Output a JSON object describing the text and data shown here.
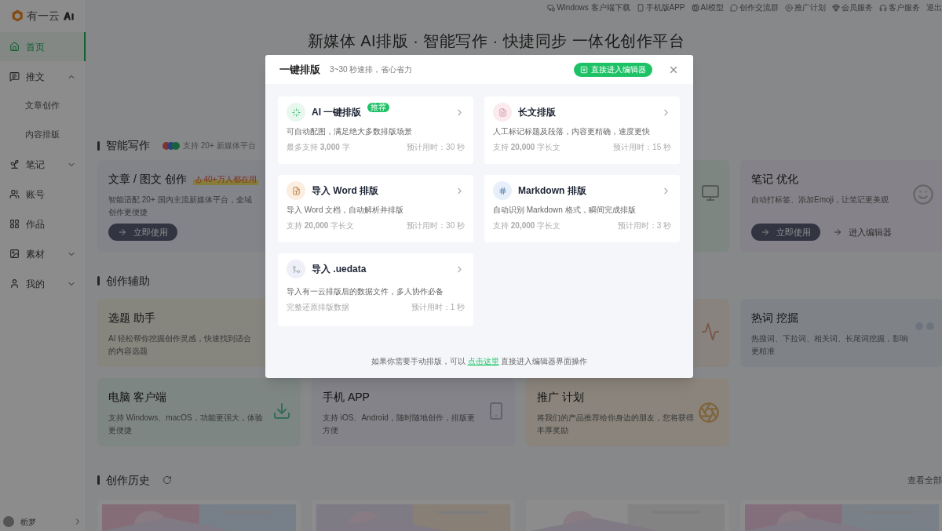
{
  "logo": {
    "text": "有一云"
  },
  "top_links": [
    "Windows 客户端下载",
    "手机版APP",
    "AI模型",
    "创作交流群",
    "推广计划",
    "会员服务",
    "客户服务",
    "退出"
  ],
  "sidebar": {
    "items": [
      {
        "label": "首页",
        "selected": true
      },
      {
        "label": "推文",
        "selected": false,
        "expanded": true,
        "children": [
          {
            "label": "文章创作",
            "selected": false
          },
          {
            "label": "内容排版",
            "selected": false
          }
        ]
      },
      {
        "label": "笔记",
        "selected": false,
        "expanded": false
      },
      {
        "label": "账号",
        "selected": false
      },
      {
        "label": "作品",
        "selected": false
      },
      {
        "label": "素材",
        "selected": false,
        "expanded": false
      },
      {
        "label": "我的",
        "selected": false,
        "expanded": false
      }
    ],
    "user": {
      "name": "栀梦"
    }
  },
  "headline": "新媒体 AI排版 · 智能写作 · 快捷同步 一体化创作平台",
  "writing": {
    "title": "智能写作",
    "note": "支持 20+ 新媒体平台",
    "cards": [
      {
        "kind": "card",
        "title": "文章 / 图文 创作",
        "tag": "40+万人都在用",
        "description": "智能适配 20+ 国内主流新媒体平台，全域创作更便捷",
        "buttons": [
          "立即使用"
        ]
      },
      {
        "kind": "covered"
      },
      {
        "kind": "covered"
      },
      {
        "kind": "card",
        "title": "笔记 优化",
        "description": "自动打标签、添加Emoji，让笔记更美观",
        "buttons": [
          "立即使用",
          "进入编辑器"
        ]
      }
    ]
  },
  "assist": {
    "title": "创作辅助",
    "cards": [
      {
        "kind": "card",
        "title": "选题 助手",
        "description": "AI 轻松帮你挖掘创作灵感，快速找到适合的内容选题"
      },
      {
        "kind": "covered"
      },
      {
        "kind": "covered"
      },
      {
        "kind": "card",
        "title": "热词 挖掘",
        "description": "热搜词、下拉词、相关词、长尾词挖掘，影响更精准"
      },
      {
        "kind": "card",
        "title": "电脑 客户端",
        "description": "支持 Windows、macOS，功能更强大，体验更便捷"
      },
      {
        "kind": "card",
        "title": "手机 APP",
        "description": "支持 iOS、Android，随时随地创作，排版更方便"
      },
      {
        "kind": "card",
        "title": "推广 计划",
        "description": "将我们的产品推荐给你身边的朋友，您将获得丰厚奖励"
      }
    ]
  },
  "history": {
    "title": "创作历史",
    "view_all": "查看全部"
  },
  "dialog": {
    "title": "一键排版",
    "subtitle": "3~30 秒速排，省心省力",
    "editor_button": "直接进入编辑器",
    "options": [
      {
        "kind": "ai",
        "title": "AI 一键排版",
        "badge": "推荐",
        "description": "可自动配图，满足绝大多数排版场景",
        "limit": "最多支持 **3,000** 字",
        "time": "预计用时：30 秒"
      },
      {
        "kind": "long",
        "title": "长文排版",
        "description": "人工标记标题及段落，内容更精确，速度更快",
        "limit": "支持 **20,000** 字长文",
        "time": "预计用时：15 秒"
      },
      {
        "kind": "word",
        "title": "导入 Word 排版",
        "description": "导入 Word 文档，自动解析并排版",
        "limit": "支持 **20,000** 字长文",
        "time": "预计用时：30 秒"
      },
      {
        "kind": "markdown",
        "title": "Markdown 排版",
        "description": "自动识别 Markdown 格式，瞬间完成排版",
        "limit": "支持 **20,000** 字长文",
        "time": "预计用时：3 秒"
      },
      {
        "kind": "data",
        "title": "导入 .uedata",
        "description": "导入有一云排版后的数据文件，多人协作必备",
        "limit": "完整还原排版数据",
        "time": "预计用时：1 秒"
      }
    ],
    "footer": {
      "before": "如果你需要手动排版，可以",
      "link": "点击这里",
      "after": "直接进入编辑器界面操作"
    }
  }
}
